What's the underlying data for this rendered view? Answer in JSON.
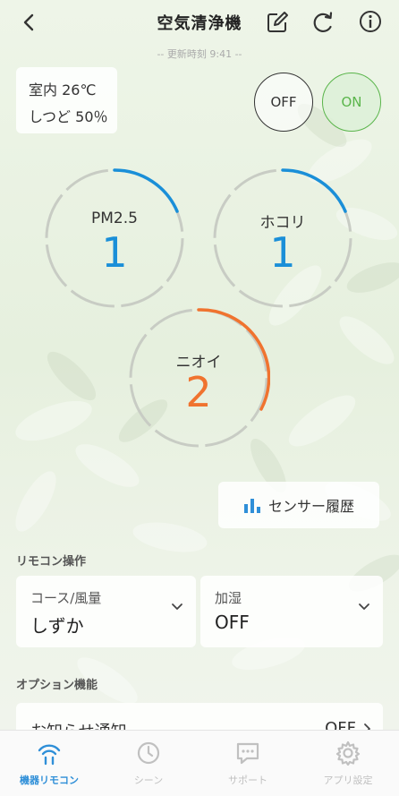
{
  "header": {
    "title": "空気清浄機",
    "updated": "-- 更新時刻 9:41 --"
  },
  "environment": {
    "temperature_label": "室内",
    "temperature": "26℃",
    "humidity_label": "しつど",
    "humidity": "50％"
  },
  "power": {
    "off_label": "OFF",
    "on_label": "ON",
    "state": "ON"
  },
  "sensors": [
    {
      "label": "PM2.5",
      "value": "1",
      "color": "#1a8fd8"
    },
    {
      "label": "ホコリ",
      "value": "1",
      "color": "#1a8fd8"
    },
    {
      "label": "ニオイ",
      "value": "2",
      "color": "#f0732f"
    }
  ],
  "history_button": "センサー履歴",
  "remote": {
    "section_title": "リモコン操作",
    "course": {
      "label": "コース/風量",
      "value": "しずか"
    },
    "humidify": {
      "label": "加湿",
      "value": "OFF"
    }
  },
  "options": {
    "section_title": "オプション機能",
    "notify": {
      "label": "お知らせ通知",
      "value": "OFF"
    }
  },
  "tabs": [
    {
      "label": "機器リモコン",
      "active": true
    },
    {
      "label": "シーン",
      "active": false
    },
    {
      "label": "サポート",
      "active": false
    },
    {
      "label": "アプリ設定",
      "active": false
    }
  ],
  "colors": {
    "accent": "#2f8fd8",
    "on_green": "#5ab54b",
    "odor_orange": "#f0732f",
    "gauge_gray": "#c8ccc4"
  }
}
